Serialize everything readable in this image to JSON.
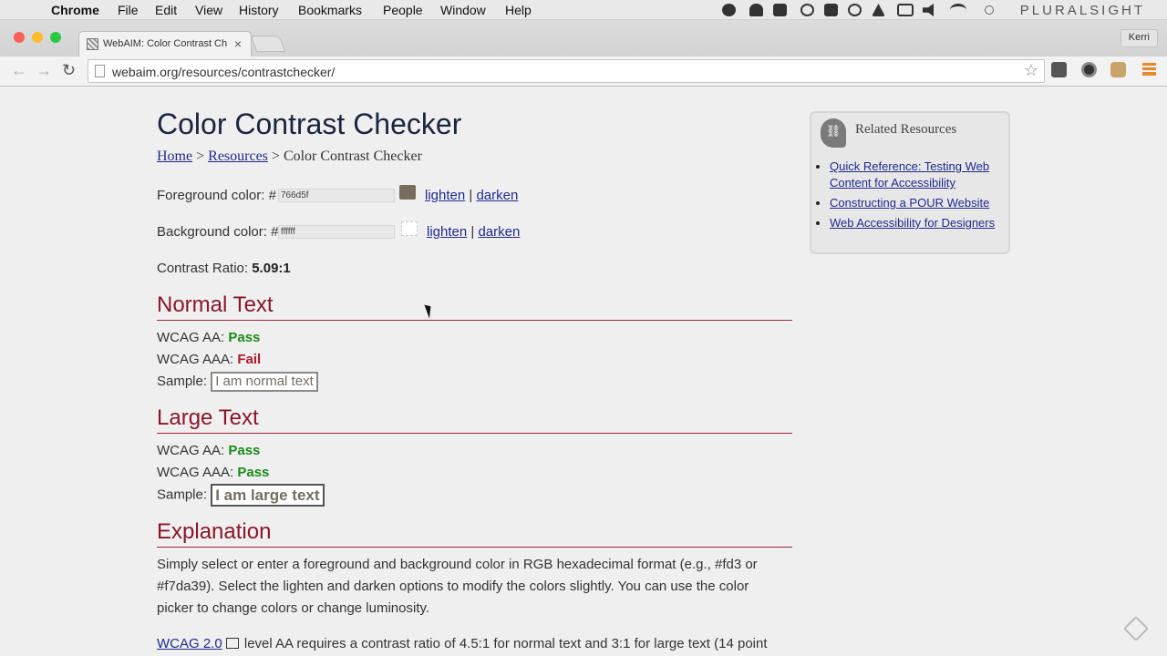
{
  "menubar": {
    "apple_glyph": "",
    "app_name": "Chrome",
    "items": [
      "File",
      "Edit",
      "View",
      "History",
      "Bookmarks",
      "People",
      "Window",
      "Help"
    ],
    "brand": "PLURALSIGHT"
  },
  "browser": {
    "tab_title": "WebAIM: Color Contrast Ch",
    "tab_close": "×",
    "profile_name": "Kerri",
    "back_glyph": "←",
    "forward_glyph": "→",
    "reload_glyph": "↻",
    "url": "webaim.org/resources/contrastchecker/",
    "star_glyph": "☆"
  },
  "page": {
    "title": "Color Contrast Checker",
    "breadcrumb": {
      "home": "Home",
      "sep1": ">",
      "resources": "Resources",
      "sep2": ">",
      "current": "Color Contrast Checker"
    },
    "foreground": {
      "label": "Foreground color: #",
      "value": "766d5f",
      "lighten": "lighten",
      "sep": "|",
      "darken": "darken",
      "swatch_color": "#766d5f"
    },
    "background": {
      "label": "Background color: #",
      "value": "ffffff",
      "lighten": "lighten",
      "sep": "|",
      "darken": "darken",
      "swatch_color": "#ffffff"
    },
    "contrast": {
      "label": "Contrast Ratio:",
      "value": "5.09:1"
    },
    "normal": {
      "heading": "Normal Text",
      "aa_label": "WCAG AA:",
      "aa_result": "Pass",
      "aaa_label": "WCAG AAA:",
      "aaa_result": "Fail",
      "sample_label": "Sample:",
      "sample_text": "I am normal text"
    },
    "large": {
      "heading": "Large Text",
      "aa_label": "WCAG AA:",
      "aa_result": "Pass",
      "aaa_label": "WCAG AAA:",
      "aaa_result": "Pass",
      "sample_label": "Sample:",
      "sample_text": "I am large text"
    },
    "explanation": {
      "heading": "Explanation",
      "paragraph": "Simply select or enter a foreground and background color in RGB hexadecimal format (e.g., #fd3 or #f7da39). Select the lighten and darken options to modify the colors slightly. You can use the color picker to change colors or change luminosity.",
      "wcag_link": "WCAG 2.0",
      "wcag_text": "level AA requires a contrast ratio of 4.5:1 for normal text and 3:1 for large text (14 point"
    }
  },
  "sidebar": {
    "title": "Related Resources",
    "links": [
      "Quick Reference: Testing Web Content for Accessibility",
      "Constructing a POUR Website",
      "Web Accessibility for Designers"
    ]
  },
  "colors": {
    "accent_heading": "#8a1628",
    "pass": "#1a8a1a",
    "fail": "#b5162b",
    "link": "#1f2a8c"
  }
}
